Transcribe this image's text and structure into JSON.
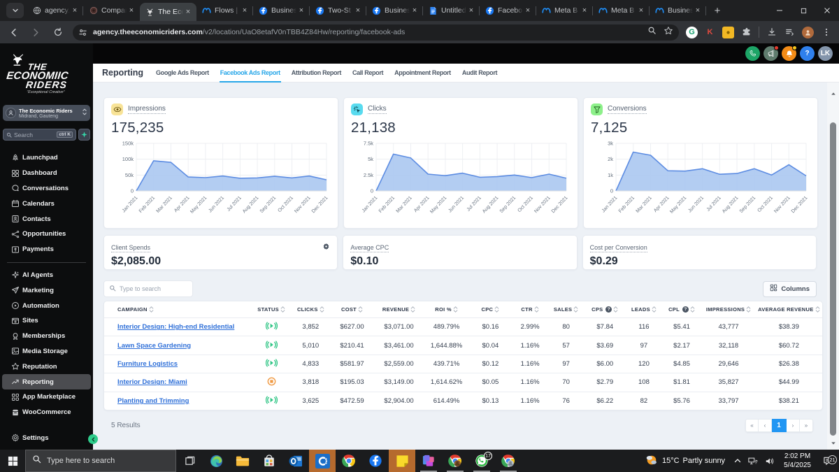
{
  "browser": {
    "tabs": [
      {
        "title": "agency.",
        "favicon": "globe"
      },
      {
        "title": "Compan",
        "favicon": "dark-circle"
      },
      {
        "title": "The Eco",
        "favicon": "crest",
        "active": true
      },
      {
        "title": "Flows |",
        "favicon": "meta"
      },
      {
        "title": "Busines",
        "favicon": "facebook"
      },
      {
        "title": "Two-St",
        "favicon": "facebook"
      },
      {
        "title": "Busines",
        "favicon": "facebook"
      },
      {
        "title": "Untitled",
        "favicon": "docs"
      },
      {
        "title": "Facebo",
        "favicon": "facebook"
      },
      {
        "title": "Meta B",
        "favicon": "meta"
      },
      {
        "title": "Meta B",
        "favicon": "meta"
      },
      {
        "title": "Busines",
        "favicon": "meta"
      }
    ],
    "url_domain": "agency.theeconomicriders.com",
    "url_path": "/v2/location/UaO8etafV0nTBB4Z84Hw/reporting/facebook-ads",
    "extensions": [
      {
        "name": "grammarly",
        "glyph": "G",
        "bg": "#ffffff",
        "fg": "#15a06e"
      },
      {
        "name": "k-extension",
        "glyph": "K",
        "bg": "transparent",
        "fg": "#e04a3f"
      },
      {
        "name": "yellow-extension",
        "glyph": "",
        "bg": "#f2b824",
        "fg": "#7a5b00"
      }
    ]
  },
  "sidebar": {
    "logo": {
      "line1": "THE",
      "line2": "ECONOMIIC",
      "line3": "RIDERS",
      "tagline": "\"Exceptional Creative\""
    },
    "account": {
      "name": "The Economic Riders",
      "location": "Midrand, Gauteng"
    },
    "search": {
      "placeholder": "Search",
      "shortcut": "ctrl K"
    },
    "items": [
      {
        "label": "Launchpad",
        "icon": "launchpad"
      },
      {
        "label": "Dashboard",
        "icon": "dashboard"
      },
      {
        "label": "Conversations",
        "icon": "conversations"
      },
      {
        "label": "Calendars",
        "icon": "calendars"
      },
      {
        "label": "Contacts",
        "icon": "contacts"
      },
      {
        "label": "Opportunities",
        "icon": "opportunities"
      },
      {
        "label": "Payments",
        "icon": "payments"
      },
      {
        "divider": true
      },
      {
        "label": "AI Agents",
        "icon": "ai-agents"
      },
      {
        "label": "Marketing",
        "icon": "marketing"
      },
      {
        "label": "Automation",
        "icon": "automation"
      },
      {
        "label": "Sites",
        "icon": "sites"
      },
      {
        "label": "Memberships",
        "icon": "memberships"
      },
      {
        "label": "Media Storage",
        "icon": "media-storage"
      },
      {
        "label": "Reputation",
        "icon": "reputation"
      },
      {
        "label": "Reporting",
        "icon": "reporting",
        "active": true
      },
      {
        "label": "App Marketplace",
        "icon": "app-marketplace"
      },
      {
        "label": "WooCommerce",
        "icon": "woocommerce"
      }
    ],
    "settings_label": "Settings"
  },
  "appbar": {
    "icons": [
      {
        "name": "phone",
        "bg": "#1da567"
      },
      {
        "name": "megaphone",
        "bg": "#5f7c6e",
        "dot": "#e23b2e"
      },
      {
        "name": "bell",
        "bg": "#f28b17",
        "dot": "#f5c51d"
      },
      {
        "name": "help",
        "bg": "#2f80ed",
        "glyph": "?"
      },
      {
        "name": "avatar",
        "bg": "#8495ab",
        "glyph": "LK"
      }
    ]
  },
  "reporting": {
    "title": "Reporting",
    "tabs": [
      "Google Ads Report",
      "Facebook Ads Report",
      "Attribution Report",
      "Call Report",
      "Appointment Report",
      "Audit Report"
    ],
    "active_tab": "Facebook Ads Report"
  },
  "chart_data": [
    {
      "type": "area",
      "title": "Impressions",
      "value": "175,235",
      "icon": "eye",
      "icon_bg": "#f8e397",
      "icon_fg": "#6b5510",
      "x": [
        "Jan 2021",
        "Feb 2021",
        "Mar 2021",
        "Apr 2021",
        "May 2021",
        "Jun 2021",
        "Jul 2021",
        "Aug 2021",
        "Sep 2021",
        "Oct 2021",
        "Nov 2021",
        "Dec 2021"
      ],
      "values": [
        0,
        95000,
        90000,
        44000,
        42000,
        47000,
        40000,
        41000,
        46000,
        41000,
        47000,
        35000
      ],
      "ylim": [
        0,
        150000
      ],
      "yticks": [
        {
          "v": 0,
          "label": "0"
        },
        {
          "v": 50000,
          "label": "50k"
        },
        {
          "v": 100000,
          "label": "100k"
        },
        {
          "v": 150000,
          "label": "150k"
        }
      ],
      "line_color": "#5c8ce2",
      "fill_color": "#abc8f1",
      "grid": true,
      "legend": false
    },
    {
      "type": "area",
      "title": "Clicks",
      "value": "21,138",
      "icon": "click",
      "icon_bg": "#59dbef",
      "icon_fg": "#0d4b56",
      "x": [
        "Jan 2021",
        "Feb 2021",
        "Mar 2021",
        "Apr 2021",
        "May 2021",
        "Jun 2021",
        "Jul 2021",
        "Aug 2021",
        "Sep 2021",
        "Oct 2021",
        "Nov 2021",
        "Dec 2021"
      ],
      "values": [
        0,
        5800,
        5200,
        2650,
        2400,
        2800,
        2150,
        2250,
        2500,
        2100,
        2650,
        2000
      ],
      "ylim": [
        0,
        7500
      ],
      "yticks": [
        {
          "v": 0,
          "label": "0"
        },
        {
          "v": 2500,
          "label": "2.5k"
        },
        {
          "v": 5000,
          "label": "5k"
        },
        {
          "v": 7500,
          "label": "7.5k"
        }
      ],
      "line_color": "#5c8ce2",
      "fill_color": "#abc8f1",
      "grid": true,
      "legend": false
    },
    {
      "type": "area",
      "title": "Conversions",
      "value": "7,125",
      "icon": "funnel",
      "icon_bg": "#8df08a",
      "icon_fg": "#1d5c1c",
      "x": [
        "Jan 2021",
        "Feb 2021",
        "Mar 2021",
        "Apr 2021",
        "May 2021",
        "Jun 2021",
        "Jul 2021",
        "Aug 2021",
        "Sep 2021",
        "Oct 2021",
        "Nov 2021",
        "Dec 2021"
      ],
      "values": [
        0,
        2450,
        2250,
        1270,
        1250,
        1400,
        1050,
        1100,
        1400,
        1000,
        1650,
        950
      ],
      "ylim": [
        0,
        3000
      ],
      "yticks": [
        {
          "v": 0,
          "label": "0"
        },
        {
          "v": 1000,
          "label": "1k"
        },
        {
          "v": 2000,
          "label": "2k"
        },
        {
          "v": 3000,
          "label": "3k"
        }
      ],
      "line_color": "#5c8ce2",
      "fill_color": "#abc8f1",
      "grid": true,
      "legend": false
    }
  ],
  "stats": [
    {
      "label": "Client Spends",
      "value": "$2,085.00",
      "gear": true
    },
    {
      "label": "Average CPC",
      "value": "$0.10"
    },
    {
      "label": "Cost per Conversion",
      "value": "$0.29"
    }
  ],
  "table": {
    "search_placeholder": "Type to search",
    "columns_label": "Columns",
    "headers": [
      {
        "label": "Campaign"
      },
      {
        "label": "Status"
      },
      {
        "label": "Clicks"
      },
      {
        "label": "Cost"
      },
      {
        "label": "Revenue"
      },
      {
        "label": "ROI %"
      },
      {
        "label": "CPC"
      },
      {
        "label": "CTR"
      },
      {
        "label": "Sales"
      },
      {
        "label": "CPS",
        "info": true
      },
      {
        "label": "Leads"
      },
      {
        "label": "CPL",
        "info": true
      },
      {
        "label": "Impressions"
      },
      {
        "label": "Average Revenue"
      }
    ],
    "rows": [
      {
        "campaign": "Interior Design: High-end Residential",
        "status": "active",
        "cells": [
          "3,852",
          "$627.00",
          "$3,071.00",
          "489.79%",
          "$0.16",
          "2.99%",
          "80",
          "$7.84",
          "116",
          "$5.41",
          "43,777",
          "$38.39"
        ]
      },
      {
        "campaign": "Lawn Space Gardening",
        "status": "active",
        "cells": [
          "5,010",
          "$210.41",
          "$3,461.00",
          "1,644.88%",
          "$0.04",
          "1.16%",
          "57",
          "$3.69",
          "97",
          "$2.17",
          "32,118",
          "$60.72"
        ]
      },
      {
        "campaign": "Furniture Logistics",
        "status": "active",
        "cells": [
          "4,833",
          "$581.97",
          "$2,559.00",
          "439.71%",
          "$0.12",
          "1.16%",
          "97",
          "$6.00",
          "120",
          "$4.85",
          "29,646",
          "$26.38"
        ]
      },
      {
        "campaign": "Interior Design: Miami",
        "status": "paused",
        "cells": [
          "3,818",
          "$195.03",
          "$3,149.00",
          "1,614.62%",
          "$0.05",
          "1.16%",
          "70",
          "$2.79",
          "108",
          "$1.81",
          "35,827",
          "$44.99"
        ]
      },
      {
        "campaign": "Planting and Trimming",
        "status": "active",
        "cells": [
          "3,625",
          "$472.59",
          "$2,904.00",
          "614.49%",
          "$0.13",
          "1.16%",
          "76",
          "$6.22",
          "82",
          "$5.76",
          "33,797",
          "$38.21"
        ]
      }
    ],
    "results_text": "5 Results",
    "pagination": {
      "first": "«",
      "prev": "‹",
      "pages": [
        "1"
      ],
      "current": "1",
      "next": "›",
      "last": "»"
    }
  },
  "taskbar": {
    "search_placeholder": "Type here to search",
    "apps": [
      {
        "name": "edge"
      },
      {
        "name": "explorer"
      },
      {
        "name": "store"
      },
      {
        "name": "outlook"
      },
      {
        "name": "clickup",
        "highlight": true
      },
      {
        "name": "chrome"
      },
      {
        "name": "facebook"
      },
      {
        "name": "stickynotes",
        "highlight": true
      },
      {
        "name": "msoffice",
        "running": true
      },
      {
        "name": "chrome-profile1",
        "running": true
      },
      {
        "name": "whatsapp",
        "running": true,
        "badge": "17"
      },
      {
        "name": "chrome-profile2",
        "running": true
      }
    ],
    "weather": {
      "temp": "15°C",
      "condition": "Partly sunny"
    },
    "clock": {
      "time": "2:02 PM",
      "date": "5/4/2025"
    },
    "notification_count": "21"
  }
}
